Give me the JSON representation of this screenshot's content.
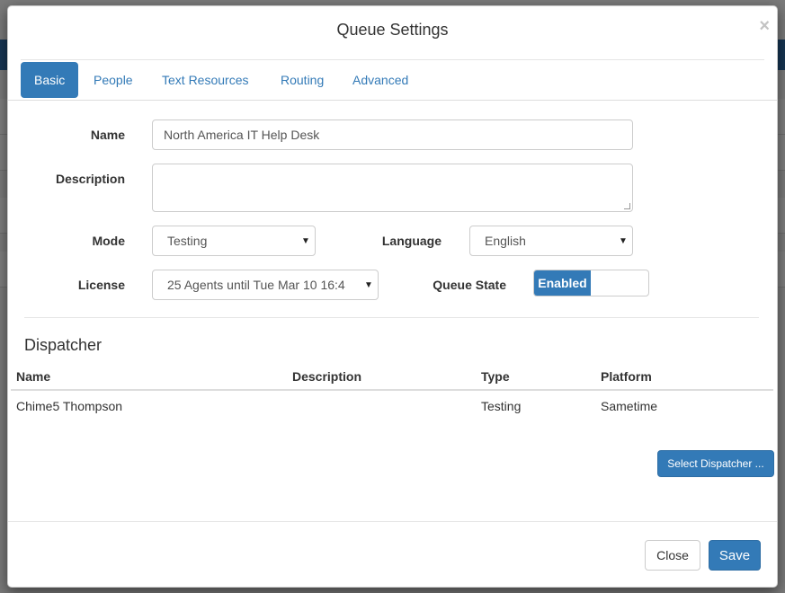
{
  "dialog": {
    "title": "Queue Settings",
    "close_glyph": "×"
  },
  "tabs": [
    {
      "label": "Basic",
      "active": true
    },
    {
      "label": "People",
      "active": false
    },
    {
      "label": "Text Resources",
      "active": false
    },
    {
      "label": "Routing",
      "active": false
    },
    {
      "label": "Advanced",
      "active": false
    }
  ],
  "form": {
    "name_label": "Name",
    "name_value": "North America IT Help Desk",
    "description_label": "Description",
    "description_value": "",
    "mode_label": "Mode",
    "mode_value": "Testing",
    "language_label": "Language",
    "language_value": "English",
    "license_label": "License",
    "license_value": "25 Agents until Tue Mar 10 16:4",
    "queue_state_label": "Queue State",
    "queue_state_value": "Enabled",
    "dropdown_arrow": "▼"
  },
  "dispatcher": {
    "title": "Dispatcher",
    "columns": [
      "Name",
      "Description",
      "Type",
      "Platform"
    ],
    "rows": [
      {
        "name": "Chime5 Thompson",
        "description": "",
        "type": "Testing",
        "platform": "Sametime"
      }
    ],
    "select_button": "Select Dispatcher ..."
  },
  "footer": {
    "close_label": "Close",
    "save_label": "Save"
  },
  "colors": {
    "primary": "#337ab7",
    "overlay": "rgba(0,0,0,0.5)"
  }
}
